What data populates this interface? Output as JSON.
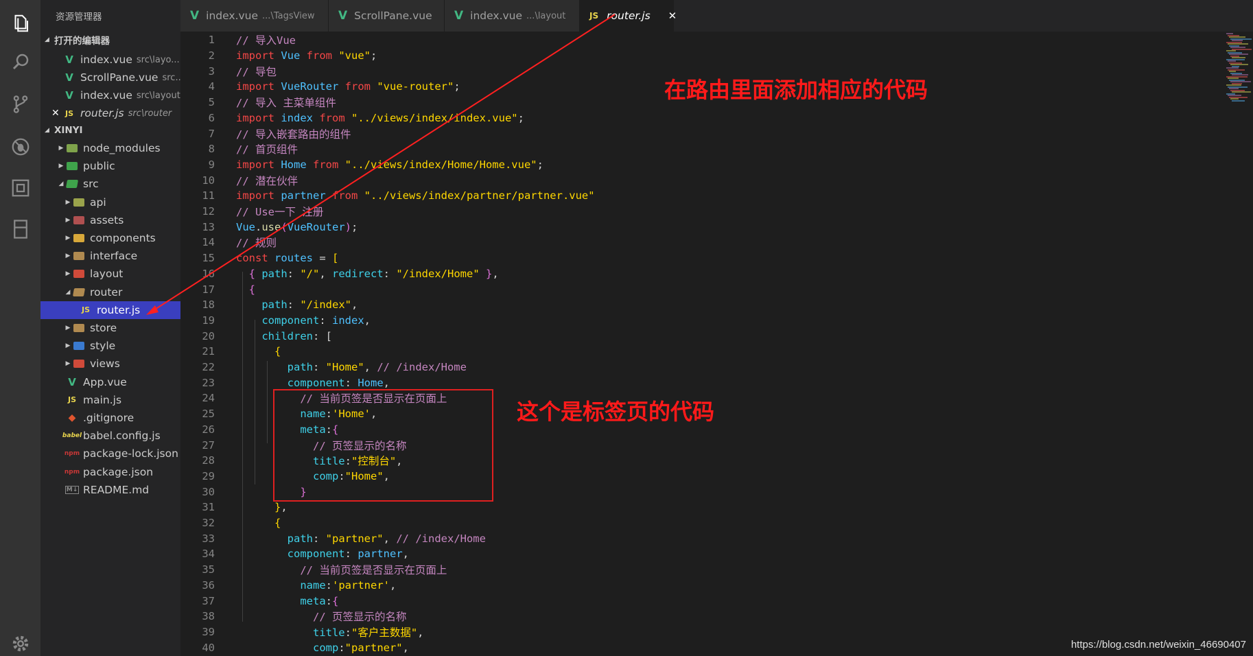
{
  "sidebar": {
    "title": "资源管理器",
    "open_editors_header": "打开的编辑器",
    "project_header": "XINYI",
    "open_editors": [
      {
        "name": "index.vue",
        "desc": "src\\layo...",
        "icon": "vue"
      },
      {
        "name": "ScrollPane.vue",
        "desc": "src...",
        "icon": "vue"
      },
      {
        "name": "index.vue",
        "desc": "src\\layout",
        "icon": "vue"
      },
      {
        "name": "router.js",
        "desc": "src\\router",
        "icon": "js",
        "active": true
      }
    ],
    "tree": [
      {
        "name": "node_modules",
        "type": "folder",
        "color": "#7fa34b"
      },
      {
        "name": "public",
        "type": "folder",
        "color": "#3fa34b"
      },
      {
        "name": "src",
        "type": "folder-open",
        "color": "#3fa34b"
      },
      {
        "name": "api",
        "type": "folder",
        "color": "#9aa34b"
      },
      {
        "name": "assets",
        "type": "folder",
        "color": "#b05050"
      },
      {
        "name": "components",
        "type": "folder",
        "color": "#d8a83a"
      },
      {
        "name": "interface",
        "type": "folder",
        "color": "#b08a50"
      },
      {
        "name": "layout",
        "type": "folder",
        "color": "#d04a3a"
      },
      {
        "name": "router",
        "type": "folder-open",
        "color": "#b08a50"
      },
      {
        "name": "router.js",
        "type": "js"
      },
      {
        "name": "store",
        "type": "folder",
        "color": "#b08a50"
      },
      {
        "name": "style",
        "type": "folder",
        "color": "#3a7ad0"
      },
      {
        "name": "views",
        "type": "folder",
        "color": "#d04a3a"
      },
      {
        "name": "App.vue",
        "type": "vue"
      },
      {
        "name": "main.js",
        "type": "js"
      },
      {
        "name": ".gitignore",
        "type": "git"
      },
      {
        "name": "babel.config.js",
        "type": "babel"
      },
      {
        "name": "package-lock.json",
        "type": "npm"
      },
      {
        "name": "package.json",
        "type": "npm"
      },
      {
        "name": "README.md",
        "type": "md"
      }
    ]
  },
  "tabs": [
    {
      "name": "index.vue",
      "desc": "...\\TagsView",
      "icon": "vue"
    },
    {
      "name": "ScrollPane.vue",
      "desc": "",
      "icon": "vue"
    },
    {
      "name": "index.vue",
      "desc": "...\\layout",
      "icon": "vue"
    },
    {
      "name": "router.js",
      "desc": "",
      "icon": "js",
      "active": true,
      "close": "✕"
    }
  ],
  "code_lines": [
    {
      "n": "1",
      "t": [
        [
          "c-com",
          "// 导入Vue"
        ]
      ]
    },
    {
      "n": "2",
      "t": [
        [
          "c-kw",
          "import "
        ],
        [
          "c-var",
          "Vue "
        ],
        [
          "c-kw",
          "from "
        ],
        [
          "c-str",
          "\"vue\""
        ],
        [
          "c-pun",
          ";"
        ]
      ]
    },
    {
      "n": "3",
      "t": [
        [
          "c-com",
          "// 导包"
        ]
      ]
    },
    {
      "n": "4",
      "t": [
        [
          "c-kw",
          "import "
        ],
        [
          "c-var",
          "VueRouter "
        ],
        [
          "c-kw",
          "from "
        ],
        [
          "c-str",
          "\"vue-router\""
        ],
        [
          "c-pun",
          ";"
        ]
      ]
    },
    {
      "n": "5",
      "t": [
        [
          "c-com",
          "// 导入 主菜单组件"
        ]
      ]
    },
    {
      "n": "6",
      "t": [
        [
          "c-kw",
          "import "
        ],
        [
          "c-var",
          "index "
        ],
        [
          "c-kw",
          "from "
        ],
        [
          "c-str",
          "\"../views/index/index.vue\""
        ],
        [
          "c-pun",
          ";"
        ]
      ]
    },
    {
      "n": "7",
      "t": [
        [
          "c-com",
          "// 导入嵌套路由的组件"
        ]
      ]
    },
    {
      "n": "8",
      "t": [
        [
          "c-com",
          "// 首页组件"
        ]
      ]
    },
    {
      "n": "9",
      "t": [
        [
          "c-kw",
          "import "
        ],
        [
          "c-var",
          "Home "
        ],
        [
          "c-kw",
          "from "
        ],
        [
          "c-str",
          "\"../views/index/Home/Home.vue\""
        ],
        [
          "c-pun",
          ";"
        ]
      ]
    },
    {
      "n": "10",
      "t": [
        [
          "c-com",
          "// 潜在伙伴"
        ]
      ]
    },
    {
      "n": "11",
      "t": [
        [
          "c-kw",
          "import "
        ],
        [
          "c-var",
          "partner "
        ],
        [
          "c-kw",
          "from "
        ],
        [
          "c-str",
          "\"../views/index/partner/partner.vue\""
        ]
      ]
    },
    {
      "n": "12",
      "t": [
        [
          "c-com",
          "// Use一下 注册"
        ]
      ]
    },
    {
      "n": "13",
      "t": [
        [
          "c-var",
          "Vue"
        ],
        [
          "c-pun",
          "."
        ],
        [
          "c-fn",
          "use"
        ],
        [
          "c-br2",
          "("
        ],
        [
          "c-var",
          "VueRouter"
        ],
        [
          "c-br2",
          ")"
        ],
        [
          "c-pun",
          ";"
        ]
      ]
    },
    {
      "n": "14",
      "t": [
        [
          "c-com",
          "// 规则"
        ]
      ]
    },
    {
      "n": "15",
      "t": [
        [
          "c-kw",
          "const "
        ],
        [
          "c-var",
          "routes "
        ],
        [
          "c-pun",
          "= "
        ],
        [
          "c-br3",
          "["
        ]
      ]
    },
    {
      "n": "16",
      "t": [
        [
          "c-pun",
          "  "
        ],
        [
          "c-br2",
          "{ "
        ],
        [
          "c-prop",
          "path"
        ],
        [
          "c-pun",
          ": "
        ],
        [
          "c-str",
          "\"/\""
        ],
        [
          "c-pun",
          ", "
        ],
        [
          "c-prop",
          "redirect"
        ],
        [
          "c-pun",
          ": "
        ],
        [
          "c-str",
          "\"/index/Home\""
        ],
        [
          "c-br2",
          " }"
        ],
        [
          "c-pun",
          ","
        ]
      ]
    },
    {
      "n": "17",
      "t": [
        [
          "c-pun",
          "  "
        ],
        [
          "c-br2",
          "{"
        ]
      ]
    },
    {
      "n": "18",
      "t": [
        [
          "c-pun",
          "    "
        ],
        [
          "c-prop",
          "path"
        ],
        [
          "c-pun",
          ": "
        ],
        [
          "c-str",
          "\"/index\""
        ],
        [
          "c-pun",
          ","
        ]
      ]
    },
    {
      "n": "19",
      "t": [
        [
          "c-pun",
          "    "
        ],
        [
          "c-prop",
          "component"
        ],
        [
          "c-pun",
          ": "
        ],
        [
          "c-var",
          "index"
        ],
        [
          "c-pun",
          ","
        ]
      ]
    },
    {
      "n": "20",
      "t": [
        [
          "c-pun",
          "    "
        ],
        [
          "c-prop",
          "children"
        ],
        [
          "c-pun",
          ": "
        ],
        [
          "c-br",
          "["
        ]
      ]
    },
    {
      "n": "21",
      "t": [
        [
          "c-pun",
          "      "
        ],
        [
          "c-br3",
          "{"
        ]
      ]
    },
    {
      "n": "22",
      "t": [
        [
          "c-pun",
          "        "
        ],
        [
          "c-prop",
          "path"
        ],
        [
          "c-pun",
          ": "
        ],
        [
          "c-str",
          "\"Home\""
        ],
        [
          "c-pun",
          ", "
        ],
        [
          "c-com",
          "// /index/Home"
        ]
      ]
    },
    {
      "n": "23",
      "t": [
        [
          "c-pun",
          "        "
        ],
        [
          "c-prop",
          "component"
        ],
        [
          "c-pun",
          ": "
        ],
        [
          "c-var",
          "Home"
        ],
        [
          "c-pun",
          ","
        ]
      ]
    },
    {
      "n": "24",
      "t": [
        [
          "c-pun",
          "          "
        ],
        [
          "c-com",
          "// 当前页签是否显示在页面上"
        ]
      ]
    },
    {
      "n": "25",
      "t": [
        [
          "c-pun",
          "          "
        ],
        [
          "c-prop",
          "name"
        ],
        [
          "c-pun",
          ":"
        ],
        [
          "c-str",
          "'Home'"
        ],
        [
          "c-pun",
          ","
        ]
      ]
    },
    {
      "n": "26",
      "t": [
        [
          "c-pun",
          "          "
        ],
        [
          "c-prop",
          "meta"
        ],
        [
          "c-pun",
          ":"
        ],
        [
          "c-br2",
          "{"
        ]
      ]
    },
    {
      "n": "27",
      "t": [
        [
          "c-pun",
          "            "
        ],
        [
          "c-com",
          "// 页签显示的名称"
        ]
      ]
    },
    {
      "n": "28",
      "t": [
        [
          "c-pun",
          "            "
        ],
        [
          "c-prop",
          "title"
        ],
        [
          "c-pun",
          ":"
        ],
        [
          "c-str",
          "\"控制台\""
        ],
        [
          "c-pun",
          ","
        ]
      ]
    },
    {
      "n": "29",
      "t": [
        [
          "c-pun",
          "            "
        ],
        [
          "c-prop",
          "comp"
        ],
        [
          "c-pun",
          ":"
        ],
        [
          "c-str",
          "\"Home\""
        ],
        [
          "c-pun",
          ","
        ]
      ]
    },
    {
      "n": "30",
      "t": [
        [
          "c-pun",
          "          "
        ],
        [
          "c-br2",
          "}"
        ]
      ]
    },
    {
      "n": "31",
      "t": [
        [
          "c-pun",
          "      "
        ],
        [
          "c-br3",
          "}"
        ],
        [
          "c-pun",
          ","
        ]
      ]
    },
    {
      "n": "32",
      "t": [
        [
          "c-pun",
          "      "
        ],
        [
          "c-br3",
          "{"
        ]
      ]
    },
    {
      "n": "33",
      "t": [
        [
          "c-pun",
          "        "
        ],
        [
          "c-prop",
          "path"
        ],
        [
          "c-pun",
          ": "
        ],
        [
          "c-str",
          "\"partner\""
        ],
        [
          "c-pun",
          ", "
        ],
        [
          "c-com",
          "// /index/Home"
        ]
      ]
    },
    {
      "n": "34",
      "t": [
        [
          "c-pun",
          "        "
        ],
        [
          "c-prop",
          "component"
        ],
        [
          "c-pun",
          ": "
        ],
        [
          "c-var",
          "partner"
        ],
        [
          "c-pun",
          ","
        ]
      ]
    },
    {
      "n": "35",
      "t": [
        [
          "c-pun",
          "          "
        ],
        [
          "c-com",
          "// 当前页签是否显示在页面上"
        ]
      ]
    },
    {
      "n": "36",
      "t": [
        [
          "c-pun",
          "          "
        ],
        [
          "c-prop",
          "name"
        ],
        [
          "c-pun",
          ":"
        ],
        [
          "c-str",
          "'partner'"
        ],
        [
          "c-pun",
          ","
        ]
      ]
    },
    {
      "n": "37",
      "t": [
        [
          "c-pun",
          "          "
        ],
        [
          "c-prop",
          "meta"
        ],
        [
          "c-pun",
          ":"
        ],
        [
          "c-br2",
          "{"
        ]
      ]
    },
    {
      "n": "38",
      "t": [
        [
          "c-pun",
          "            "
        ],
        [
          "c-com",
          "// 页签显示的名称"
        ]
      ]
    },
    {
      "n": "39",
      "t": [
        [
          "c-pun",
          "            "
        ],
        [
          "c-prop",
          "title"
        ],
        [
          "c-pun",
          ":"
        ],
        [
          "c-str",
          "\"客户主数据\""
        ],
        [
          "c-pun",
          ","
        ]
      ]
    },
    {
      "n": "40",
      "t": [
        [
          "c-pun",
          "            "
        ],
        [
          "c-prop",
          "comp"
        ],
        [
          "c-pun",
          ":"
        ],
        [
          "c-str",
          "\"partner\""
        ],
        [
          "c-pun",
          ","
        ]
      ]
    }
  ],
  "annotations": {
    "route_note": "在路由里面添加相应的代码",
    "tab_note": "这个是标签页的代码"
  },
  "watermark": "https://blog.csdn.net/weixin_46690407",
  "colors": {
    "accent": "#3a3fbf",
    "annotation": "#ff1a1a"
  }
}
